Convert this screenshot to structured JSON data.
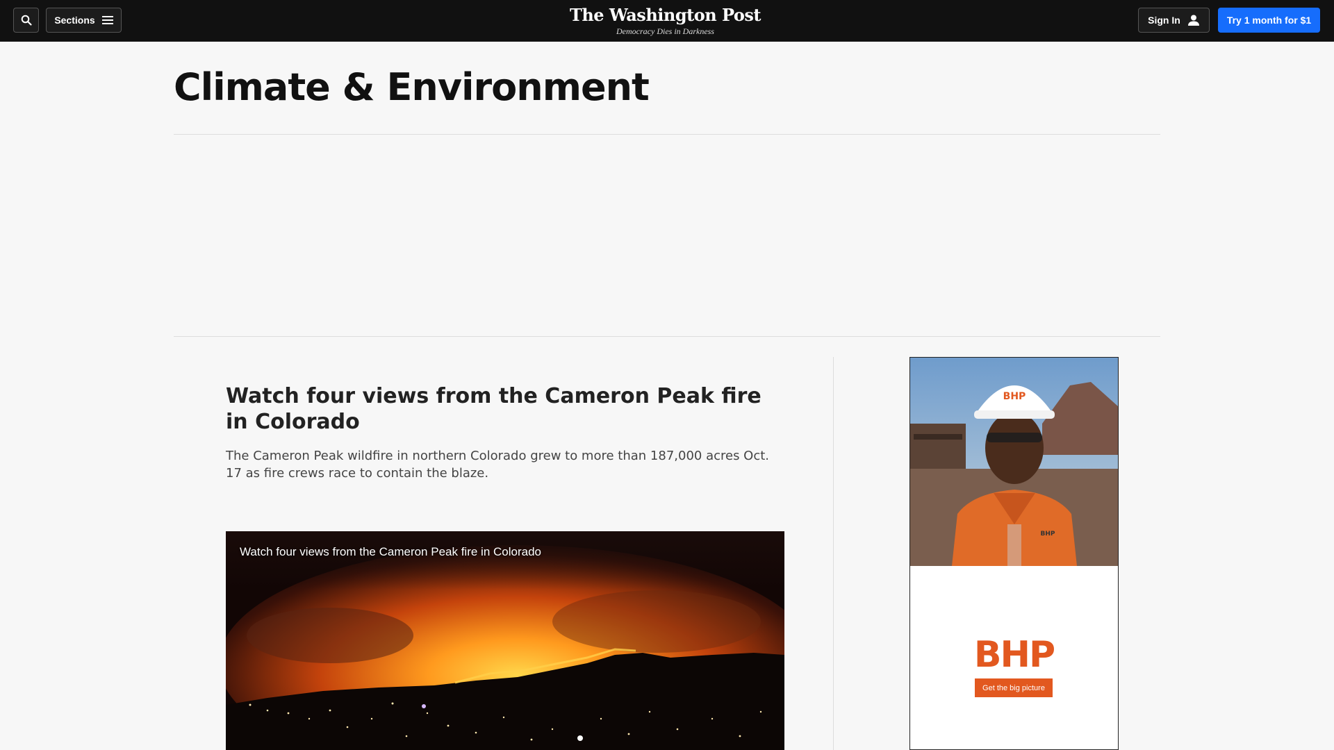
{
  "header": {
    "search_icon": "search-icon",
    "sections_label": "Sections",
    "menu_icon": "hamburger-menu-icon",
    "logo": "The Washington Post",
    "tagline": "Democracy Dies in Darkness",
    "signin_label": "Sign In",
    "user_icon": "user-icon",
    "subscribe_label": "Try 1 month for $1",
    "accent_color": "#166dfc"
  },
  "section": {
    "title": "Climate & Environment"
  },
  "article": {
    "headline": "Watch four views from the Cameron Peak fire in Colorado",
    "blurb": "The Cameron Peak wildfire in northern Colorado grew to more than 187,000 acres Oct. 17 as fire crews race to contain the blaze.",
    "video_title": "Watch four views from the Cameron Peak fire in Colorado"
  },
  "sidebar_ad": {
    "brand": "BHP",
    "cta": "Get the big picture",
    "brand_color": "#e2581f"
  }
}
